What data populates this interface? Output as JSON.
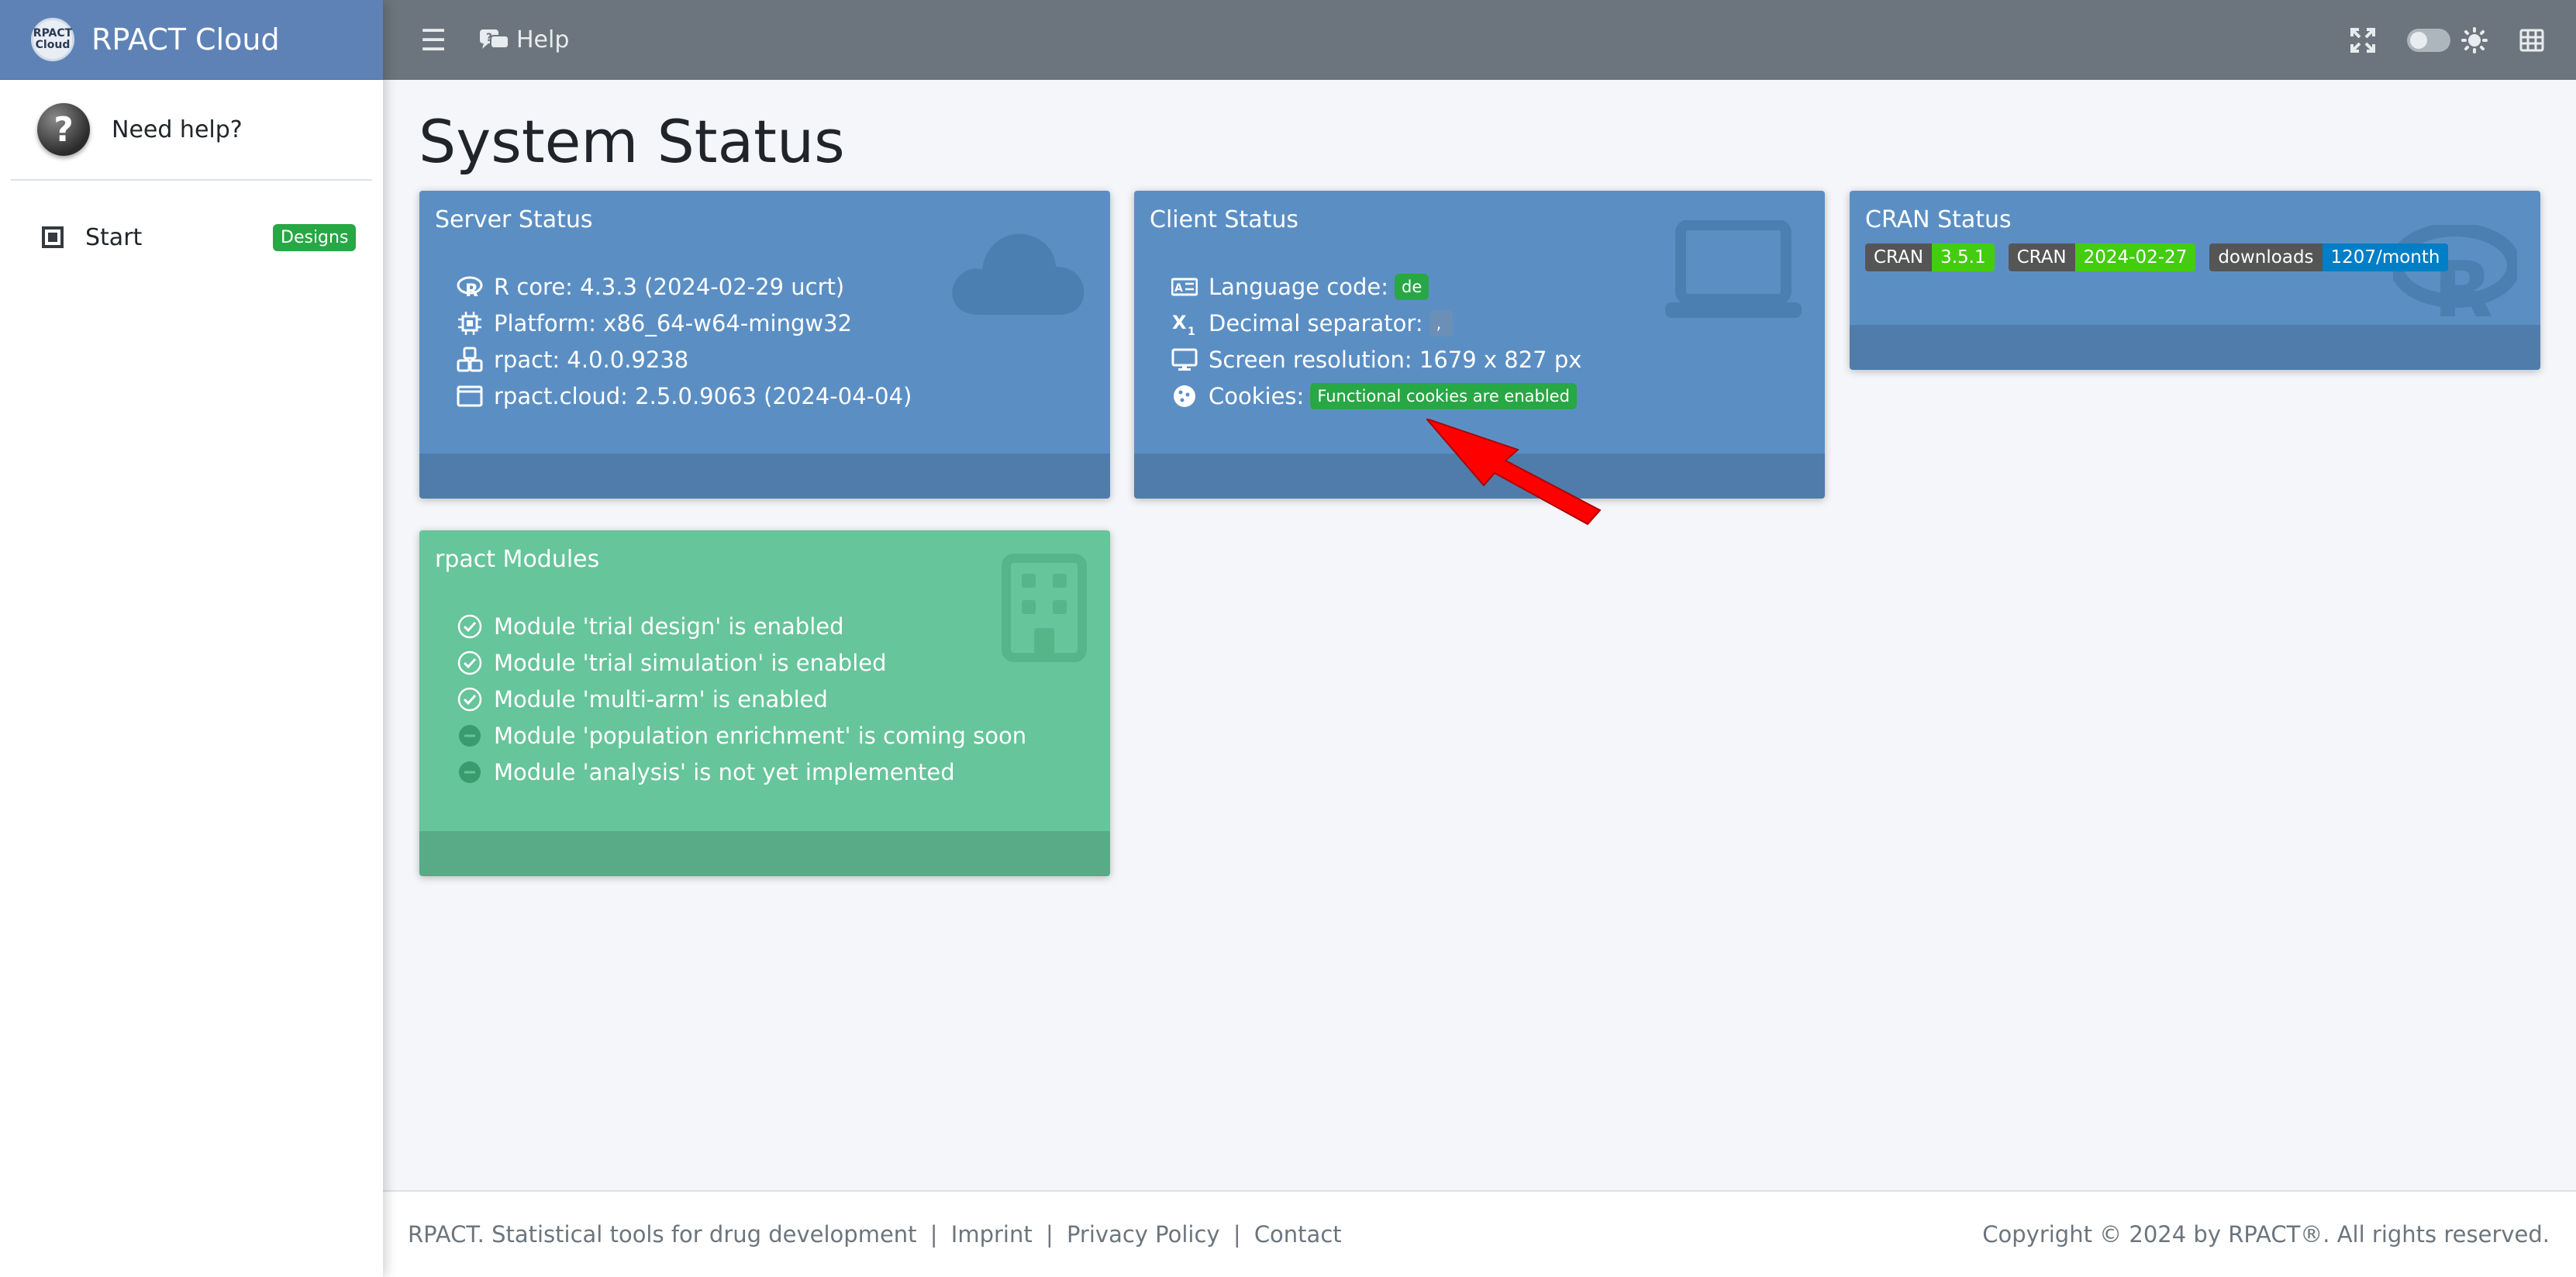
{
  "brand": {
    "name": "RPACT Cloud",
    "logo_line1": "RPACT",
    "logo_line2": "Cloud"
  },
  "sidebar": {
    "help_label": "Need help?",
    "help_avatar_glyph": "?",
    "items": [
      {
        "label": "Start",
        "badge": "Designs"
      }
    ]
  },
  "topbar": {
    "menu_icon": "hamburger-icon",
    "help_label": "Help",
    "right_icons": [
      "fullscreen-icon",
      "theme-toggle",
      "sun-icon",
      "grid-icon"
    ]
  },
  "page": {
    "title": "System Status"
  },
  "server_status": {
    "title": "Server Status",
    "items": [
      {
        "icon": "r-logo-icon",
        "text": "R core: 4.3.3 (2024-02-29 ucrt)"
      },
      {
        "icon": "chip-icon",
        "text": "Platform: x86_64-w64-mingw32"
      },
      {
        "icon": "cubes-icon",
        "text": "rpact: 4.0.0.9238"
      },
      {
        "icon": "window-icon",
        "text": "rpact.cloud: 2.5.0.9063 (2024-04-04)"
      }
    ]
  },
  "client_status": {
    "title": "Client Status",
    "items": [
      {
        "icon": "language-icon",
        "label": "Language code:",
        "badge": "de"
      },
      {
        "icon": "subscript-icon",
        "label": "Decimal separator:",
        "badge": ","
      },
      {
        "icon": "monitor-icon",
        "label": "Screen resolution: 1679 x 827 px"
      },
      {
        "icon": "cookie-icon",
        "label": "Cookies:",
        "badge": "Functional cookies are enabled"
      }
    ]
  },
  "cran_status": {
    "title": "CRAN Status",
    "shields": [
      {
        "key": "CRAN",
        "value": "3.5.1"
      },
      {
        "key": "CRAN",
        "value": "2024-02-27"
      },
      {
        "key": "downloads",
        "value": "1207/month"
      }
    ]
  },
  "modules": {
    "title": "rpact Modules",
    "items": [
      {
        "icon": "check-circle-icon",
        "text": "Module 'trial design' is enabled"
      },
      {
        "icon": "check-circle-icon",
        "text": "Module 'trial simulation' is enabled"
      },
      {
        "icon": "check-circle-icon",
        "text": "Module 'multi-arm' is enabled"
      },
      {
        "icon": "minus-circle-icon",
        "text": "Module 'population enrichment' is coming soon"
      },
      {
        "icon": "minus-circle-icon",
        "text": "Module 'analysis' is not yet implemented"
      }
    ]
  },
  "footer": {
    "tagline": "RPACT. Statistical tools for drug development",
    "links": [
      "Imprint",
      "Privacy Policy",
      "Contact"
    ],
    "separator": "|",
    "copyright": "Copyright © 2024 by RPACT®. All rights reserved."
  },
  "colors": {
    "brand": "#5f82b6",
    "topbar": "#6c757d",
    "card_blue": "#5b8fc4",
    "card_green": "#66c59a",
    "badge_green": "#28a745",
    "arrow_red": "#ff0000"
  }
}
